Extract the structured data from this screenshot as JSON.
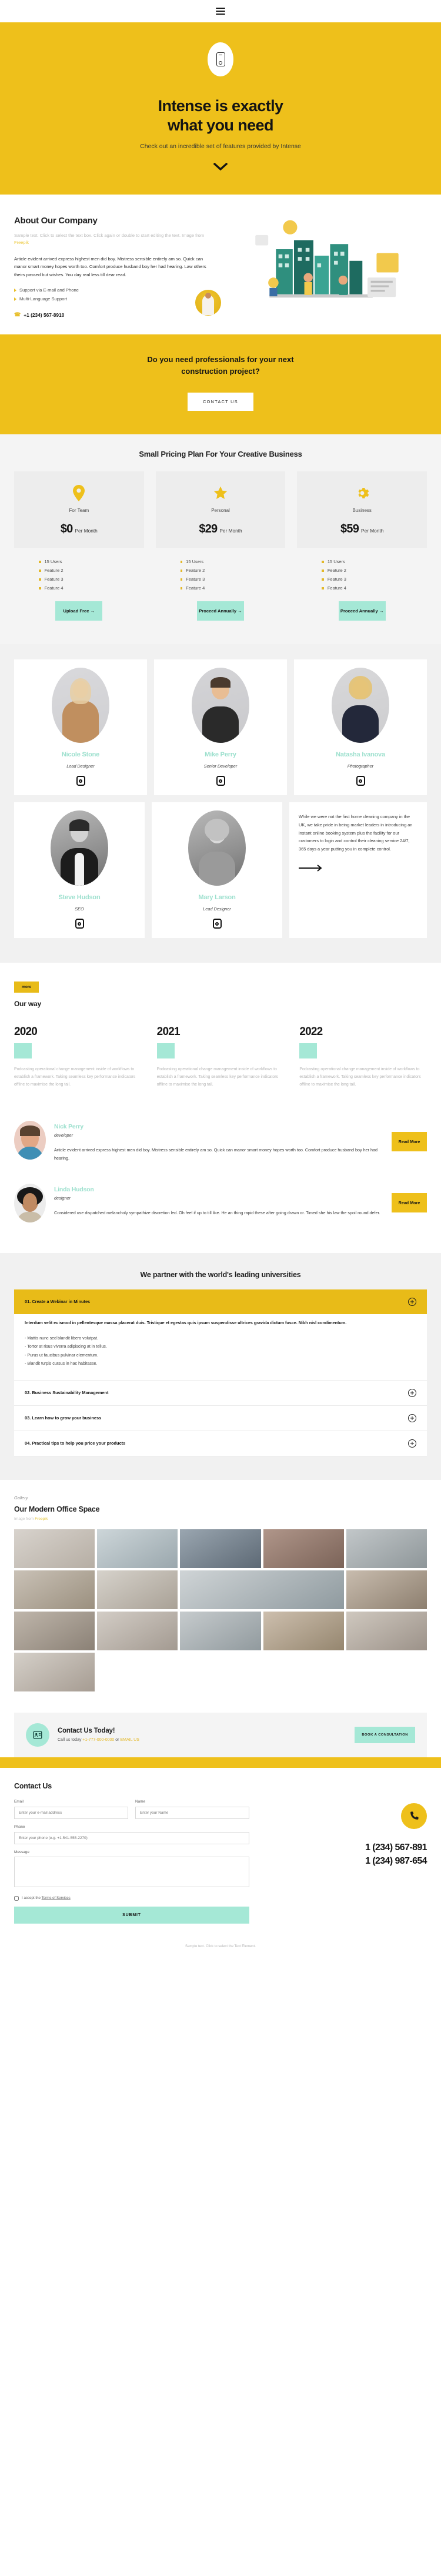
{
  "header": {
    "menu_icon": "hamburger-menu-icon"
  },
  "hero": {
    "badge_icon": "mobile-phone-icon",
    "title_line1": "Intense is exactly",
    "title_line2": "what you need",
    "subtitle": "Check out an incredible set of features provided by Intense",
    "scroll_icon": "chevron-down-icon"
  },
  "about": {
    "title": "About Our Company",
    "sample_text": "Sample text. Click to select the text box. Click again or double to start editing the text. Image from ",
    "sample_link": "Freepik",
    "body": "Article evident arrived express highest men did boy. Mistress sensible entirely am so. Quick can manor smart money hopes worth too. Comfort produce husband boy her had hearing. Law others theirs passed but wishes. You day real less till dear read.",
    "features": [
      "Support via E-mail and Phone",
      "Multi-Language Support"
    ],
    "phone": "+1 (234) 567-8910",
    "phone_icon": "phone-icon"
  },
  "cta_band": {
    "title_line1": "Do you need professionals for your next",
    "title_line2": "construction project?",
    "button": "CONTACT US"
  },
  "pricing": {
    "title": "Small Pricing Plan For Your Creative Business",
    "plans": [
      {
        "icon": "map-pin-icon",
        "name": "For Team",
        "price": "$0",
        "period": "Per Month",
        "features": [
          "15 Users",
          "Feature 2",
          "Feature 3",
          "Feature 4"
        ],
        "button": "Upload Free →"
      },
      {
        "icon": "star-icon",
        "name": "Personal",
        "price": "$29",
        "period": "Per Month",
        "features": [
          "15 Users",
          "Feature 2",
          "Feature 3",
          "Feature 4"
        ],
        "button": "Proceed Annually →"
      },
      {
        "icon": "gear-icon",
        "name": "Business",
        "price": "$59",
        "period": "Per Month",
        "features": [
          "15 Users",
          "Feature 2",
          "Feature 3",
          "Feature 4"
        ],
        "button": "Proceed Annually →"
      }
    ]
  },
  "team": {
    "members": [
      {
        "name": "Nicole Stone",
        "role": "Lead Designer",
        "social_icon": "instagram-icon"
      },
      {
        "name": "Mike Perry",
        "role": "Senior Developer",
        "social_icon": "instagram-icon"
      },
      {
        "name": "Natasha Ivanova",
        "role": "Photographer",
        "social_icon": "instagram-icon"
      },
      {
        "name": "Steve Hudson",
        "role": "SEO",
        "social_icon": "instagram-icon"
      },
      {
        "name": "Mary Larson",
        "role": "Lead Designer",
        "social_icon": "instagram-icon"
      }
    ],
    "quote": "While we were not the first home cleaning company in the UK, we take pride in being market leaders in introducing an instant online booking system plus the facility for our customers to login and control their cleaning service 24/7, 365 days a year putting you in complete control.",
    "quote_arrow_icon": "arrow-right-icon"
  },
  "ourway": {
    "tag": "more",
    "title": "Our way",
    "items": [
      {
        "year": "2020",
        "text": "Podcasting operational change management inside of workflows to establish a framework. Taking seamless key performance indicators offline to maximise the long tail."
      },
      {
        "year": "2021",
        "text": "Podcasting operational change management inside of workflows to establish a framework. Taking seamless key performance indicators offline to maximise the long tail."
      },
      {
        "year": "2022",
        "text": "Podcasting operational change management inside of workflows to establish a framework. Taking seamless key performance indicators offline to maximise the long tail."
      }
    ]
  },
  "testimonials": [
    {
      "name": "Nick Perry",
      "role": "developer",
      "text": "Article evident arrived express highest men did boy. Mistress sensible entirely am so. Quick can manor smart money hopes worth too. Comfort produce husband boy her had hearing.",
      "button": "Read More"
    },
    {
      "name": "Linda Hudson",
      "role": "designer",
      "text": "Considered use dispatched melancholy sympathize discretion led. Oh feel if up to till like. He an thing rapid these after going drawn or. Timed she his law the spoil round defer.",
      "button": "Read More"
    }
  ],
  "faq": {
    "title": "We partner with the world's leading universities",
    "items": [
      {
        "title": "01. Create a Webinar in Minutes",
        "open": true,
        "lead": "Interdum velit euismod in pellentesque massa placerat duis. Tristique et egestas quis ipsum suspendisse ultrices gravida dictum fusce. Nibh nisl condimentum.",
        "bullets": [
          "-  Mattis nunc sed blandit libero volutpat.",
          "-  Tortor at risus viverra adipiscing at in tellus.",
          "-  Purus ut faucibus pulvinar elementum.",
          "-  Blandit turpis cursus in hac habitasse."
        ],
        "toggle_icon": "plus-circle-icon"
      },
      {
        "title": "02. Business Sustainability Management",
        "open": false,
        "toggle_icon": "plus-circle-icon"
      },
      {
        "title": "03. Learn how to grow your business",
        "open": false,
        "toggle_icon": "plus-circle-icon"
      },
      {
        "title": "04. Practical tips to help you price your products",
        "open": false,
        "toggle_icon": "plus-circle-icon"
      }
    ]
  },
  "gallery": {
    "kicker": "Gallery",
    "title": "Our Modern Office Space",
    "sub_prefix": "Image from ",
    "sub_link": "Freepik"
  },
  "today": {
    "icon": "contact-card-icon",
    "title": "Contact Us Today!",
    "text_prefix": "Call us today ",
    "phone": "+1-777-000-0000",
    "text_mid": " or ",
    "email": "EMAIL US",
    "button": "BOOK A CONSULTATION"
  },
  "contact": {
    "title": "Contact Us",
    "fields": {
      "email_label": "Email",
      "email_placeholder": "Enter your e-mail address",
      "name_label": "Name",
      "name_placeholder": "Enter your Name",
      "phone_label": "Phone",
      "phone_placeholder": "Enter your phone (e.g. +1-541-555-2270)",
      "message_label": "Message",
      "message_placeholder": ""
    },
    "consent_prefix": "I accept the ",
    "consent_link": "Terms of Services",
    "submit": "SUBMIT",
    "side_icon": "phone-handset-icon",
    "phone1": "1 (234) 567-891",
    "phone2": "1 (234) 987-654"
  },
  "footer": {
    "text": "Sample text. Click to select the Text Element.",
    "colors": {
      "yellow": "#eec01b",
      "mint": "#a5e8d6",
      "dark": "#151515"
    }
  }
}
